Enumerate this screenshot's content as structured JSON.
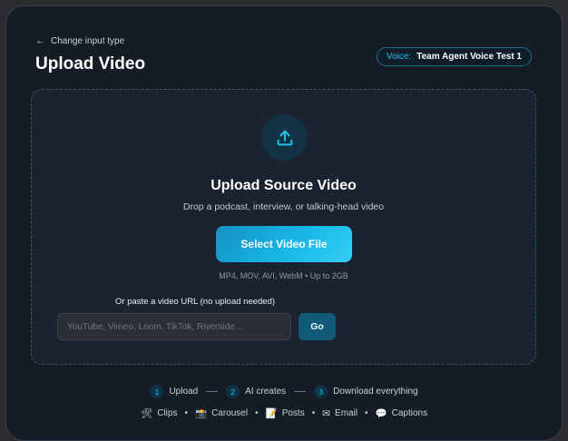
{
  "header": {
    "back_label": "Change input type",
    "title": "Upload Video",
    "voice_key": "Voice:",
    "voice_value": "Team Agent Voice Test 1"
  },
  "dropzone": {
    "icon": "upload-icon",
    "title": "Upload Source Video",
    "subtitle": "Drop a podcast, interview, or talking-head video",
    "select_button": "Select Video File",
    "formats": "MP4, MOV, AVI, WebM • Up to 2GB",
    "url_label": "Or paste a video URL (no upload needed)",
    "url_placeholder": "YouTube, Vimeo, Loom, TikTok, Riverside...",
    "url_value": "",
    "go_button": "Go"
  },
  "steps": [
    {
      "num": "1",
      "label": "Upload"
    },
    {
      "num": "2",
      "label": "AI creates"
    },
    {
      "num": "3",
      "label": "Download everything"
    }
  ],
  "outputs": [
    {
      "icon": "🛠",
      "icon_name": "tools-icon",
      "label": "Clips"
    },
    {
      "icon": "📸",
      "icon_name": "camera-icon",
      "label": "Carousel"
    },
    {
      "icon": "📝",
      "icon_name": "memo-icon",
      "label": "Posts"
    },
    {
      "icon": "✉",
      "icon_name": "envelope-icon",
      "label": "Email"
    },
    {
      "icon": "💬",
      "icon_name": "speech-bubble-icon",
      "label": "Captions"
    }
  ],
  "colors": {
    "accent": "#22c2ee",
    "panel": "#161c26",
    "dropzone": "#1b2330"
  }
}
